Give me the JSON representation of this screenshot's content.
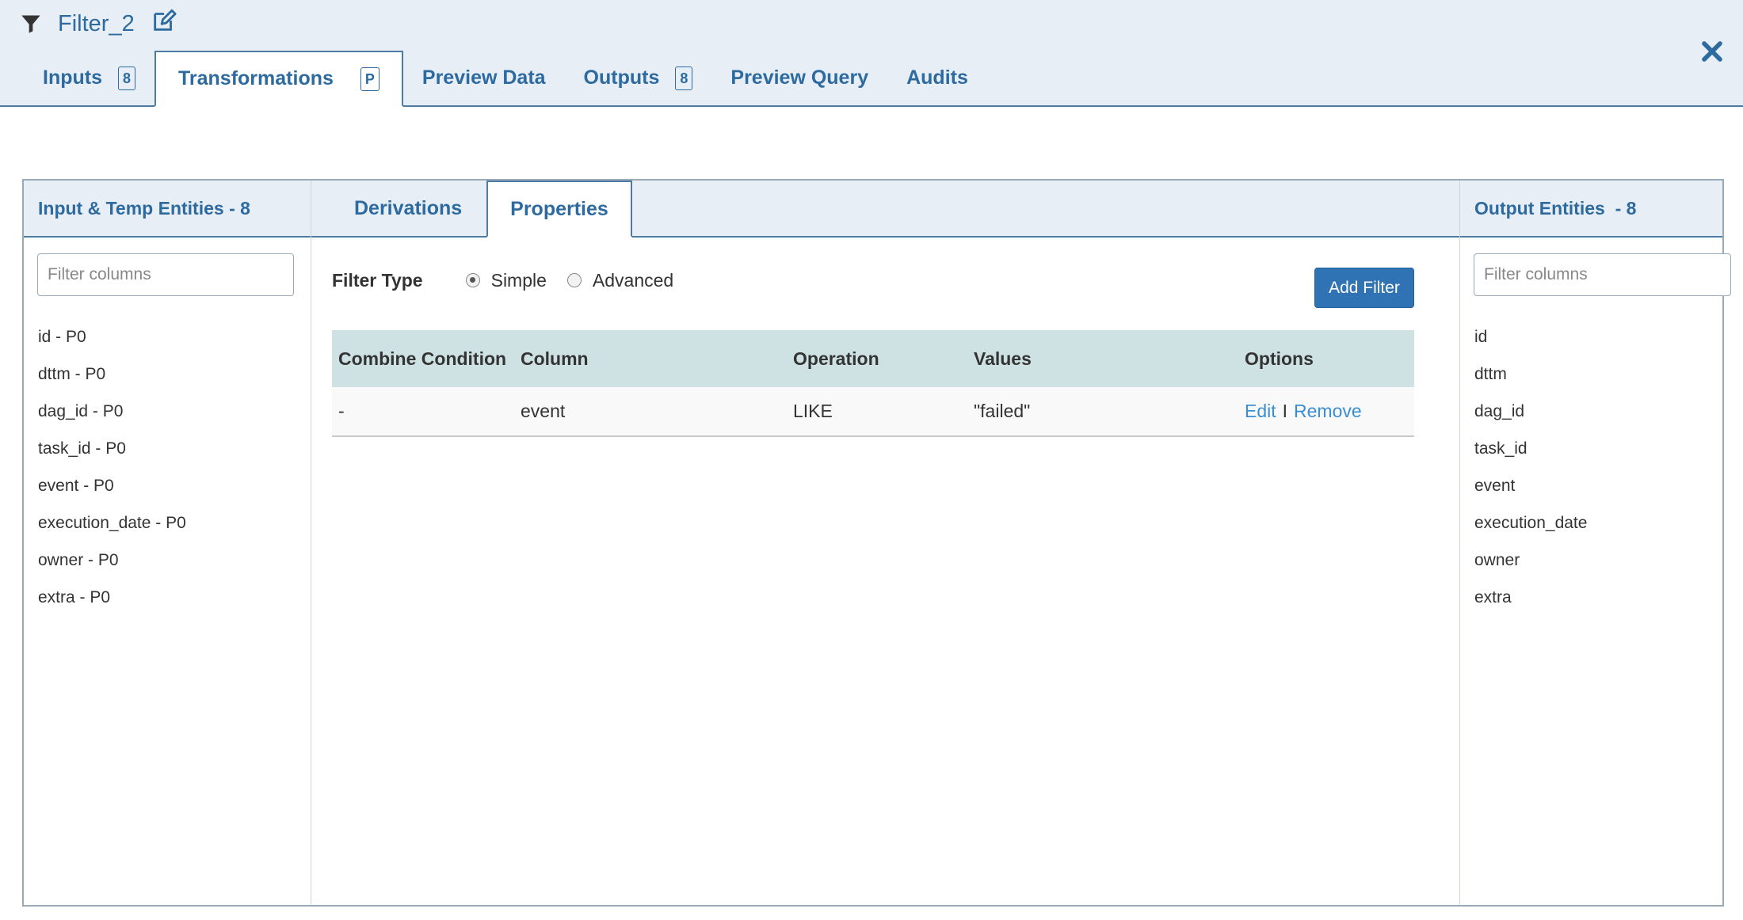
{
  "header": {
    "title": "Filter_2",
    "tabs": [
      {
        "label": "Inputs",
        "badge": "8"
      },
      {
        "label": "Transformations",
        "badge": "P"
      },
      {
        "label": "Preview Data",
        "badge": ""
      },
      {
        "label": "Outputs",
        "badge": "8"
      },
      {
        "label": "Preview Query",
        "badge": ""
      },
      {
        "label": "Audits",
        "badge": ""
      }
    ]
  },
  "left_panel": {
    "heading": "Input & Temp Entities - 8",
    "filter_placeholder": "Filter columns",
    "columns": [
      "id - P0",
      "dttm - P0",
      "dag_id - P0",
      "task_id - P0",
      "event - P0",
      "execution_date - P0",
      "owner - P0",
      "extra - P0"
    ]
  },
  "middle_panel": {
    "tabs": {
      "derivations": "Derivations",
      "properties": "Properties"
    },
    "filter_type_label": "Filter Type",
    "radio_simple": "Simple",
    "radio_advanced": "Advanced",
    "add_filter_label": "Add Filter",
    "table": {
      "headers": [
        "Combine Condition",
        "Column",
        "Operation",
        "Values",
        "Options"
      ],
      "rows": [
        {
          "combine": "-",
          "column": "event",
          "operation": "LIKE",
          "values": "\"failed\"",
          "edit": "Edit",
          "sep": "I",
          "remove": "Remove"
        }
      ]
    }
  },
  "right_panel": {
    "heading": "Output Entities  - 8",
    "filter_placeholder": "Filter columns",
    "columns": [
      "id",
      "dttm",
      "dag_id",
      "task_id",
      "event",
      "execution_date",
      "owner",
      "extra"
    ]
  }
}
